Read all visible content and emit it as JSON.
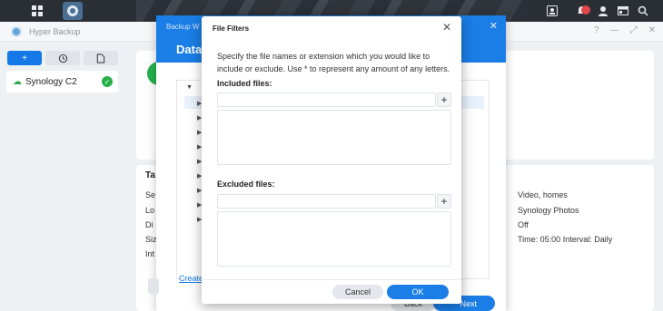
{
  "app": {
    "name": "Hyper Backup"
  },
  "sidebar": {
    "items": [
      {
        "label": "Synology C2"
      }
    ]
  },
  "info": {
    "heading": "Ta",
    "labels": [
      "Se",
      "Lo",
      "Di",
      "Siz",
      "Int"
    ],
    "values": [
      "Video, homes",
      "Synology Photos",
      "Off",
      "Time: 05:00 Interval: Daily"
    ]
  },
  "wizard": {
    "title": "Backup W",
    "heading": "Data B",
    "link_label": "Create",
    "back_label": "Back",
    "next_label": "Next"
  },
  "dialog": {
    "title": "File Filters",
    "description": "Specify the file names or extension which you would like to include or exclude. Use * to represent any amount of any letters.",
    "included_label": "Included files:",
    "included_value": "",
    "excluded_label": "Excluded files:",
    "excluded_value": "",
    "cancel_label": "Cancel",
    "ok_label": "OK"
  },
  "colors": {
    "accent": "#1a7ee6",
    "success": "#27b04b"
  }
}
